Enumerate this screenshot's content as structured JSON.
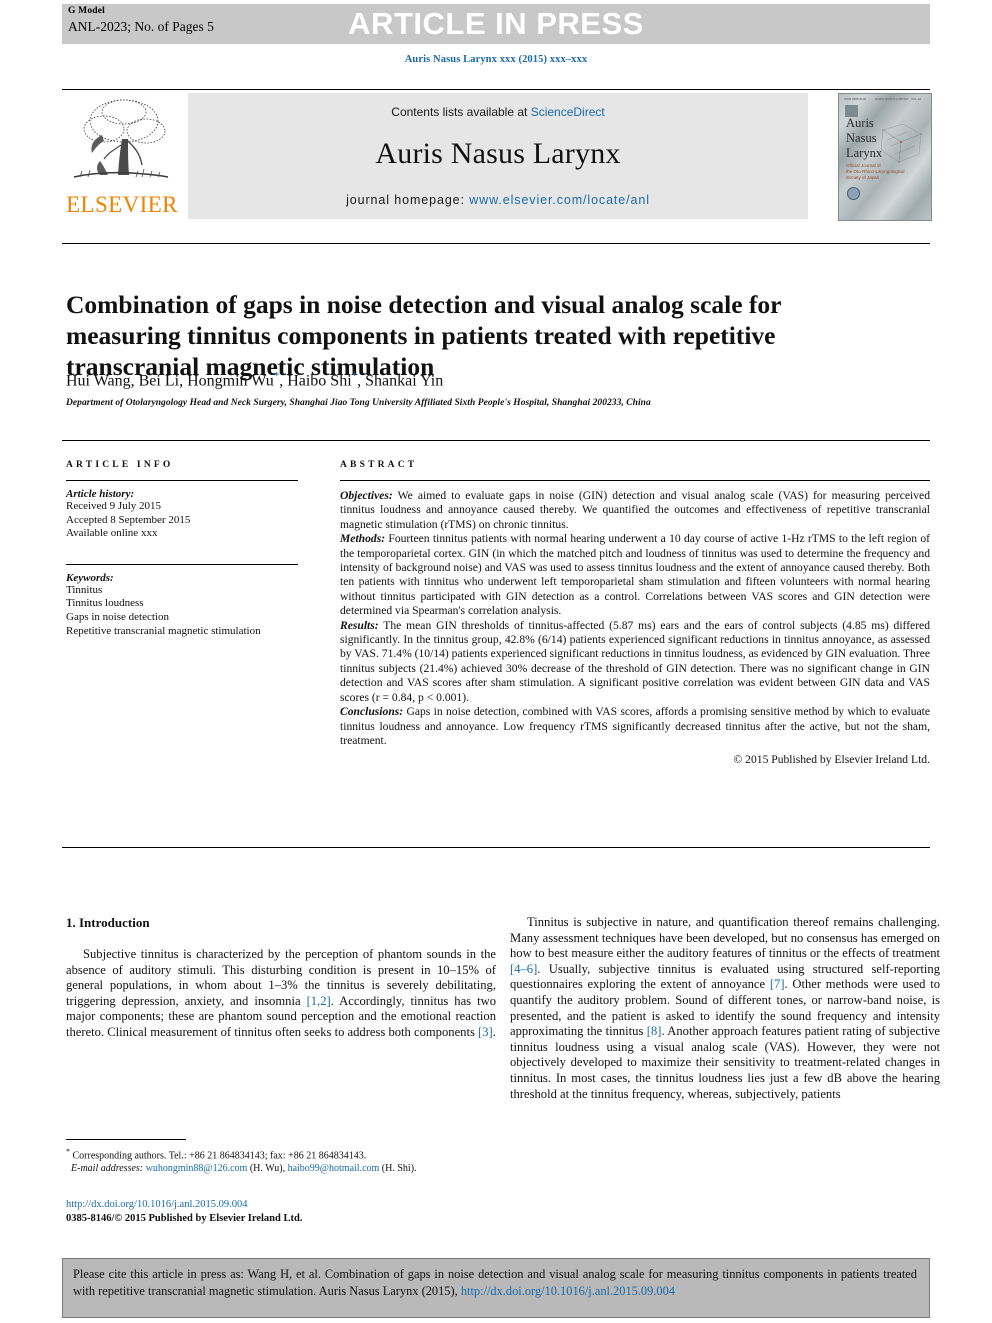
{
  "header": {
    "g_model": "G Model",
    "article_id": "ANL-2023; No. of Pages 5",
    "banner": "ARTICLE IN PRESS",
    "journal_ref": "Auris Nasus Larynx xxx (2015) xxx–xxx"
  },
  "masthead": {
    "publisher": "ELSEVIER",
    "contents_prefix": "Contents lists available at ",
    "contents_link": "ScienceDirect",
    "journal_name": "Auris Nasus Larynx",
    "homepage_label": "journal homepage: ",
    "homepage_url": "www.elsevier.com/locate/anl",
    "cover_title": "Auris\nNasus\nLarynx",
    "cover_subtitle": "Official Journal of\nthe Oto-Rhino-Laryngological\nSociety of Japan"
  },
  "article": {
    "title": "Combination of gaps in noise detection and visual analog scale for measuring tinnitus components in patients treated with repetitive transcranial magnetic stimulation",
    "authors": "Hui Wang, Bei Li, Hongmin Wu",
    "authors_full": "Hui Wang, Bei Li, Hongmin Wu *, Haibo Shi *, Shankai Yin",
    "author_part1": "Hui Wang, Bei Li, Hongmin Wu",
    "author_part2": ", Haibo Shi",
    "author_part3": ", Shankai Yin",
    "affiliation": "Department of Otolaryngology Head and Neck Surgery, Shanghai Jiao Tong University Affiliated Sixth People's Hospital, Shanghai 200233, China"
  },
  "article_info": {
    "heading": "ARTICLE INFO",
    "history_label": "Article history:",
    "history": [
      "Received 9 July 2015",
      "Accepted 8 September 2015",
      "Available online xxx"
    ],
    "keywords_label": "Keywords:",
    "keywords": [
      "Tinnitus",
      "Tinnitus loudness",
      "Gaps in noise detection",
      "Repetitive transcranial magnetic stimulation"
    ]
  },
  "abstract": {
    "heading": "ABSTRACT",
    "objectives_label": "Objectives:",
    "objectives": " We aimed to evaluate gaps in noise (GIN) detection and visual analog scale (VAS) for measuring perceived tinnitus loudness and annoyance caused thereby. We quantified the outcomes and effectiveness of repetitive transcranial magnetic stimulation (rTMS) on chronic tinnitus.",
    "methods_label": "Methods:",
    "methods": " Fourteen tinnitus patients with normal hearing underwent a 10 day course of active 1-Hz rTMS to the left region of the temporoparietal cortex. GIN (in which the matched pitch and loudness of tinnitus was used to determine the frequency and intensity of background noise) and VAS was used to assess tinnitus loudness and the extent of annoyance caused thereby. Both ten patients with tinnitus who underwent left temporoparietal sham stimulation and fifteen volunteers with normal hearing without tinnitus participated with GIN detection as a control. Correlations between VAS scores and GIN detection were determined via Spearman's correlation analysis.",
    "results_label": "Results:",
    "results": " The mean GIN thresholds of tinnitus-affected (5.87 ms) ears and the ears of control subjects (4.85 ms) differed significantly. In the tinnitus group, 42.8% (6/14) patients experienced significant reductions in tinnitus annoyance, as assessed by VAS. 71.4% (10/14) patients experienced significant reductions in tinnitus loudness, as evidenced by GIN evaluation. Three tinnitus subjects (21.4%) achieved 30% decrease of the threshold of GIN detection. There was no significant change in GIN detection and VAS scores after sham stimulation. A significant positive correlation was evident between GIN data and VAS scores (r = 0.84, p < 0.001).",
    "conclusions_label": "Conclusions:",
    "conclusions": " Gaps in noise detection, combined with VAS scores, affords a promising sensitive method by which to evaluate tinnitus loudness and annoyance. Low frequency rTMS significantly decreased tinnitus after the active, but not the sham, treatment.",
    "copyright": "© 2015 Published by Elsevier Ireland Ltd."
  },
  "introduction": {
    "heading": "1. Introduction",
    "left_para_a": "Subjective tinnitus is characterized by the perception of phantom sounds in the absence of auditory stimuli. This disturbing condition is present in 10–15% of general populations, in whom about 1–3% the tinnitus is severely debilitating, triggering depression, anxiety, and insomnia ",
    "left_ref_1": "[1,2]",
    "left_para_b": ". Accordingly, tinnitus has two major components; these are phantom sound perception and the emotional reaction thereto. Clinical measurement of tinnitus often seeks to address both components ",
    "left_ref_2": "[3]",
    "left_para_c": ".",
    "right_para_a": "Tinnitus is subjective in nature, and quantification thereof remains challenging. Many assessment techniques have been developed, but no consensus has emerged on how to best measure either the auditory features of tinnitus or the effects of treatment ",
    "right_ref_1": "[4–6]",
    "right_para_b": ". Usually, subjective tinnitus is evaluated using structured self-reporting questionnaires exploring the extent of annoyance ",
    "right_ref_2": "[7]",
    "right_para_c": ". Other methods were used to quantify the auditory problem. Sound of different tones, or narrow-band noise, is presented, and the patient is asked to identify the sound frequency and intensity approximating the tinnitus ",
    "right_ref_3": "[8]",
    "right_para_d": ". Another approach features patient rating of subjective tinnitus loudness using a visual analog scale (VAS). However, they were not objectively developed to maximize their sensitivity to treatment-related changes in tinnitus. In most cases, the tinnitus loudness lies just a few dB above the hearing threshold at the tinnitus frequency, whereas, subjectively, patients"
  },
  "footnotes": {
    "corresponding": "Corresponding authors. Tel.: +86 21 864834143; fax: +86 21 864834143.",
    "email_label": "E-mail addresses:",
    "email_1": "wuhongmin88@126.com",
    "email_1_owner": " (H. Wu), ",
    "email_2": "haibo99@hotmail.com",
    "email_2_owner": " (H. Shi).",
    "doi_url": "http://dx.doi.org/10.1016/j.anl.2015.09.004",
    "issn_line": "0385-8146/© 2015 Published by Elsevier Ireland Ltd."
  },
  "cite_box": {
    "text": "Please cite this article in press as: Wang H, et al. Combination of gaps in noise detection and visual analog scale for measuring tinnitus components in patients treated with repetitive transcranial magnetic stimulation. Auris Nasus Larynx (2015), ",
    "link": "http://dx.doi.org/10.1016/j.anl.2015.09.004"
  },
  "colors": {
    "link": "#1a6aa8",
    "elsevier_orange": "#ef8200",
    "banner_grey": "#c8c8c8",
    "panel_grey": "#e6e6e6",
    "cite_grey": "#b9b9b9"
  }
}
